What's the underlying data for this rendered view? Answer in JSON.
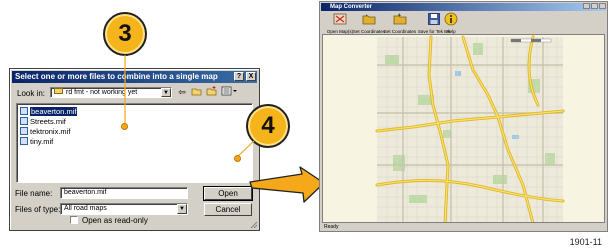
{
  "dialog": {
    "title": "Select one or more files to combine into a single map",
    "help_button": "?",
    "close_button": "X",
    "look_in_label": "Look in:",
    "look_in_value": "rd fmt - not working yet",
    "files": [
      "beaverton.mif",
      "Streets.mif",
      "tektronix.mif",
      "tiny.mif"
    ],
    "file_name_label": "File name:",
    "file_name_value": "beaverton.mif",
    "files_of_type_label": "Files of type:",
    "files_of_type_value": "All road maps",
    "read_only_label": "Open as read-only",
    "open_button": "Open",
    "cancel_button": "Cancel"
  },
  "callouts": {
    "step3": "3",
    "step4": "4"
  },
  "map_window": {
    "title": "Map Converter",
    "toolbar": [
      {
        "label": "Open Map(s)",
        "icon": "open-maps-icon"
      },
      {
        "label": "Set Coordinates",
        "icon": "folder-icon"
      },
      {
        "label": "Set Coordinates",
        "icon": "folder-icon"
      },
      {
        "label": "Save for Tek Mk",
        "icon": "save-disk-icon"
      },
      {
        "label": "Help",
        "icon": "info-icon"
      }
    ],
    "status": "Ready"
  },
  "figure_number": "1901-11",
  "colors": {
    "title_bar": "#0a246a",
    "callout": "#f6b41c",
    "map_background": "#f7f4e2",
    "freeway": "#f3d24a"
  }
}
